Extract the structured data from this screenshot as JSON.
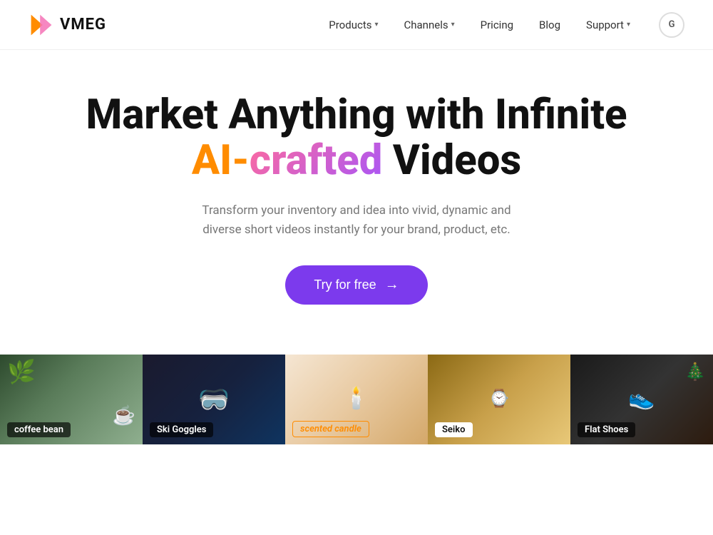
{
  "logo": {
    "text": "VMEG"
  },
  "nav": {
    "items": [
      {
        "label": "Products",
        "has_dropdown": true
      },
      {
        "label": "Channels",
        "has_dropdown": true
      },
      {
        "label": "Pricing",
        "has_dropdown": false
      },
      {
        "label": "Blog",
        "has_dropdown": false
      },
      {
        "label": "Support",
        "has_dropdown": true
      }
    ],
    "cta_label": "G"
  },
  "hero": {
    "title_line1": "Market Anything with Infinite",
    "title_ai": "AI-",
    "title_crafted": "crafted",
    "title_videos": " Videos",
    "subtitle": "Transform your inventory and idea into vivid, dynamic and diverse short videos instantly for your brand, product, etc.",
    "cta_label": "Try for free",
    "cta_arrow": "→"
  },
  "products": [
    {
      "label": "coffee bean",
      "label_style": "default",
      "card_class": "card-coffee"
    },
    {
      "label": "Ski Goggles",
      "label_style": "default",
      "card_class": "card-ski"
    },
    {
      "label": "scented candle",
      "label_style": "orange",
      "card_class": "card-candle"
    },
    {
      "label": "Seiko",
      "label_style": "seiko",
      "card_class": "card-seiko"
    },
    {
      "label": "Flat Shoes",
      "label_style": "default",
      "card_class": "card-shoes"
    }
  ],
  "colors": {
    "accent_purple": "#7c3aed",
    "accent_orange": "#ff8c00",
    "gradient_pink": "#ff6b9d",
    "gradient_purple": "#a855f7"
  }
}
